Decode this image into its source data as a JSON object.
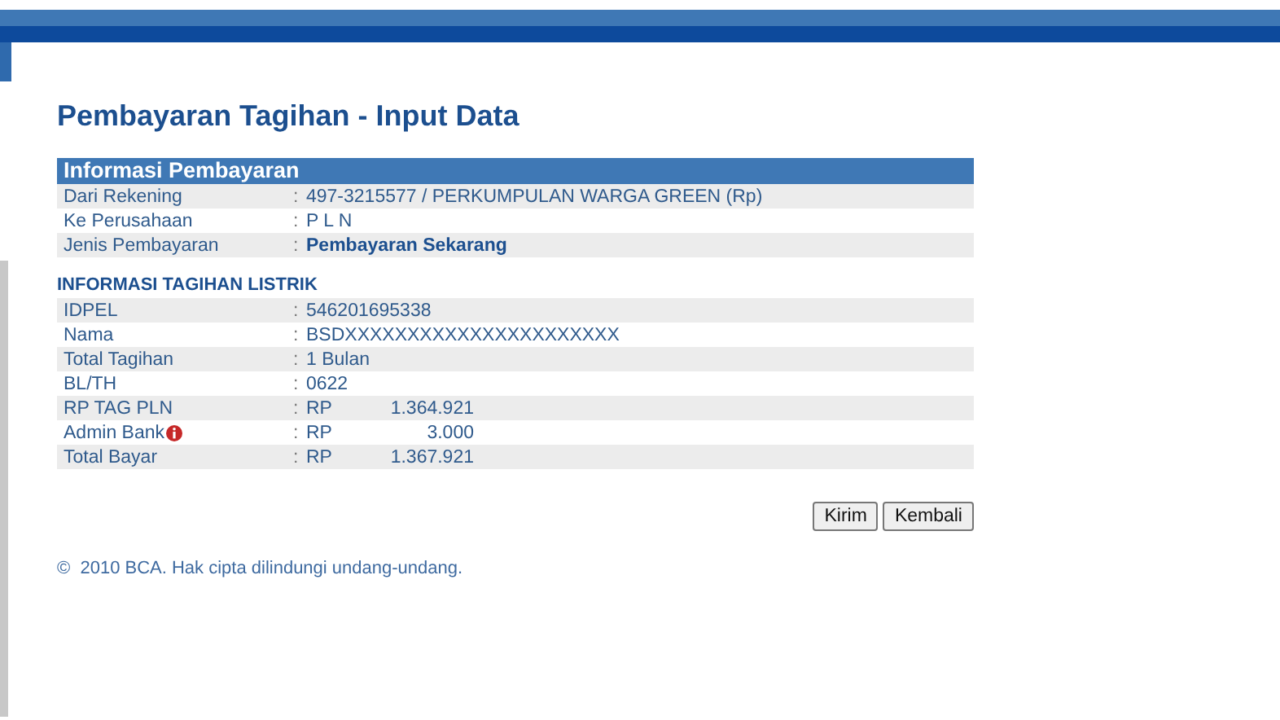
{
  "title": "Pembayaran Tagihan - Input Data",
  "payment_info": {
    "heading": "Informasi Pembayaran",
    "rows": [
      {
        "label": "Dari Rekening",
        "separator": ":",
        "kind": "text",
        "value": "497-3215577 / PERKUMPULAN WARGA GREEN (Rp)"
      },
      {
        "label": "Ke Perusahaan",
        "separator": ":",
        "kind": "text",
        "value": "P L N"
      },
      {
        "label": "Jenis Pembayaran",
        "separator": ":",
        "kind": "bold",
        "value": "Pembayaran Sekarang"
      }
    ]
  },
  "bill_info": {
    "heading": "INFORMASI TAGIHAN LISTRIK",
    "rows": [
      {
        "label": "IDPEL",
        "separator": ":",
        "kind": "text",
        "value": "546201695338"
      },
      {
        "label": "Nama",
        "separator": ":",
        "kind": "text",
        "value": "BSDXXXXXXXXXXXXXXXXXXXXXX"
      },
      {
        "label": "Total Tagihan",
        "separator": ":",
        "kind": "text",
        "value": "1 Bulan"
      },
      {
        "label": "BL/TH",
        "separator": ":",
        "kind": "text",
        "value": "0622"
      },
      {
        "label": "RP TAG PLN",
        "separator": ":",
        "kind": "amount",
        "currency": "RP",
        "value": "1.364.921"
      },
      {
        "label": "Admin Bank",
        "info": true,
        "separator": ":",
        "kind": "amount",
        "currency": "RP",
        "value": "3.000"
      },
      {
        "label": "Total Bayar",
        "separator": ":",
        "kind": "amount",
        "currency": "RP",
        "value": "1.367.921"
      }
    ]
  },
  "buttons": [
    "Kirim",
    "Kembali"
  ],
  "footer": "©  2010 BCA. Hak cipta dilindungi undang-undang."
}
